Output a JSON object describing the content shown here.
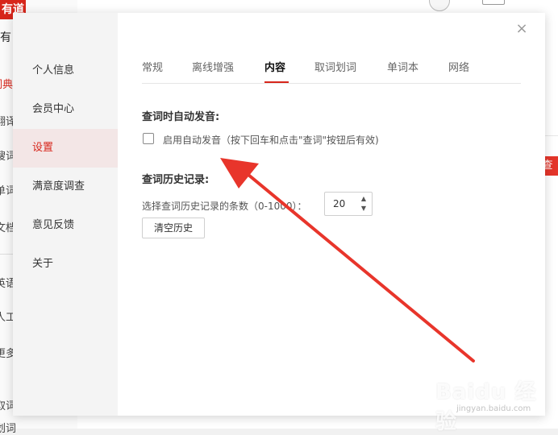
{
  "background": {
    "logo_text": "有道",
    "brand_text": "有",
    "nav": [
      {
        "label": "词典",
        "active": true
      },
      {
        "label": "翻译"
      },
      {
        "label": "搜词"
      },
      {
        "label": "单词"
      },
      {
        "label": "文档"
      },
      {
        "label": "英语"
      },
      {
        "label": "人工"
      },
      {
        "label": "更多"
      },
      {
        "label": "取词"
      },
      {
        "label": "划词"
      }
    ],
    "search_button": "查"
  },
  "dialog": {
    "close_icon": "×",
    "sidebar": [
      {
        "label": "个人信息"
      },
      {
        "label": "会员中心"
      },
      {
        "label": "设置",
        "active": true
      },
      {
        "label": "满意度调查"
      },
      {
        "label": "意见反馈"
      },
      {
        "label": "关于"
      }
    ],
    "tabs": [
      {
        "label": "常规"
      },
      {
        "label": "离线增强"
      },
      {
        "label": "内容",
        "active": true
      },
      {
        "label": "取词划词"
      },
      {
        "label": "单词本"
      },
      {
        "label": "网络"
      }
    ],
    "auto_pronounce": {
      "title": "查词时自动发音:",
      "checkbox_label": "启用自动发音（按下回车和点击\"查词\"按钮后有效)",
      "checked": false
    },
    "history": {
      "title": "查词历史记录:",
      "count_label": "选择查词历史记录的条数（0-1000）：",
      "count_value": "20",
      "clear_button": "清空历史"
    }
  },
  "watermark": {
    "text": "Baidu 经验",
    "sub": "jingyan.baidu.com"
  },
  "colors": {
    "accent": "#d7261b",
    "annotation_arrow": "#e8352b"
  }
}
